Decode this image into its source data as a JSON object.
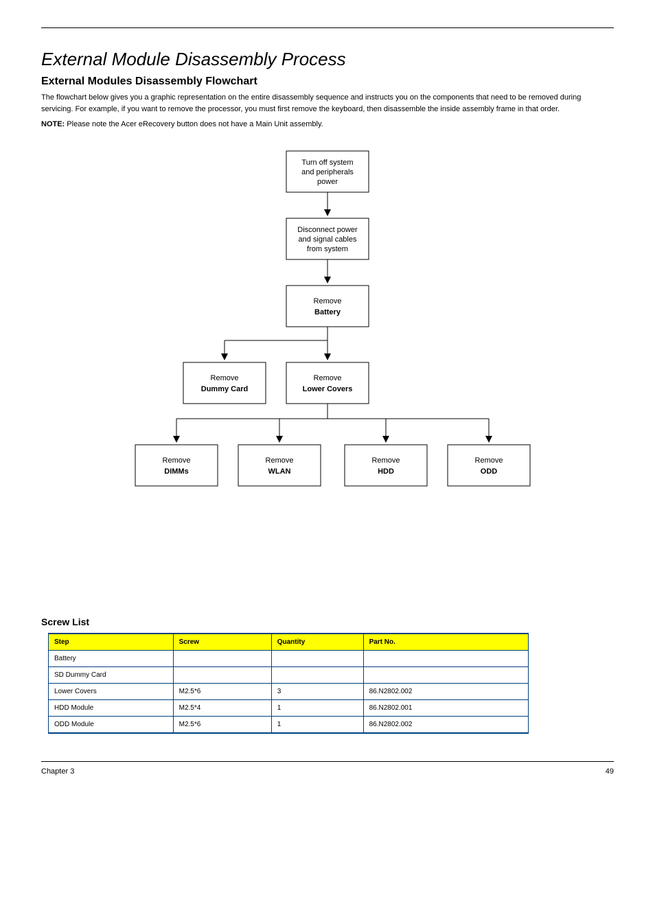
{
  "header": {
    "title": "External Module Disassembly Process",
    "subtitle": "External Modules Disassembly Flowchart",
    "intro": "The flowchart below gives you a graphic representation on the entire disassembly sequence and instructs you on the components that need to be removed during servicing. For example, if you want to remove the processor, you must first remove the keyboard, then disassemble the inside assembly frame in that order.",
    "note_label": "NOTE:",
    "note_text": " Please note the Acer eRecovery button does not have a Main Unit assembly."
  },
  "flow": {
    "b1": {
      "line1": "Turn off system",
      "line2": "and peripherals",
      "line3": "power"
    },
    "b2": {
      "line1": "Disconnect power",
      "line2": "and signal cables",
      "line3": "from system"
    },
    "b3": {
      "line1": "Remove",
      "line2": "Battery"
    },
    "b4": {
      "line1": "Remove",
      "line2": "Dummy Card"
    },
    "b5": {
      "line1": "Remove",
      "line2": "Lower Covers"
    },
    "b6": {
      "line1": "Remove",
      "line2": "DIMMs"
    },
    "b7": {
      "line1": "Remove",
      "line2": "WLAN"
    },
    "b8": {
      "line1": "Remove",
      "line2": "HDD"
    },
    "b9": {
      "line1": "Remove",
      "line2": "ODD"
    }
  },
  "screw_title": "Screw List",
  "table": {
    "headers": [
      "Step",
      "Screw",
      "Quantity",
      "Part No."
    ],
    "rows": [
      [
        "Battery",
        "",
        "",
        ""
      ],
      [
        "SD Dummy Card",
        "",
        "",
        ""
      ],
      [
        "Lower Covers",
        "M2.5*6",
        "3",
        "86.N2802.002"
      ],
      [
        "HDD Module",
        "M2.5*4",
        "1",
        "86.N2802.001"
      ],
      [
        "ODD Module",
        "M2.5*6",
        "1",
        "86.N2802.002"
      ]
    ]
  },
  "footer": {
    "left": "",
    "right": "Chapter 3",
    "page": "49"
  }
}
